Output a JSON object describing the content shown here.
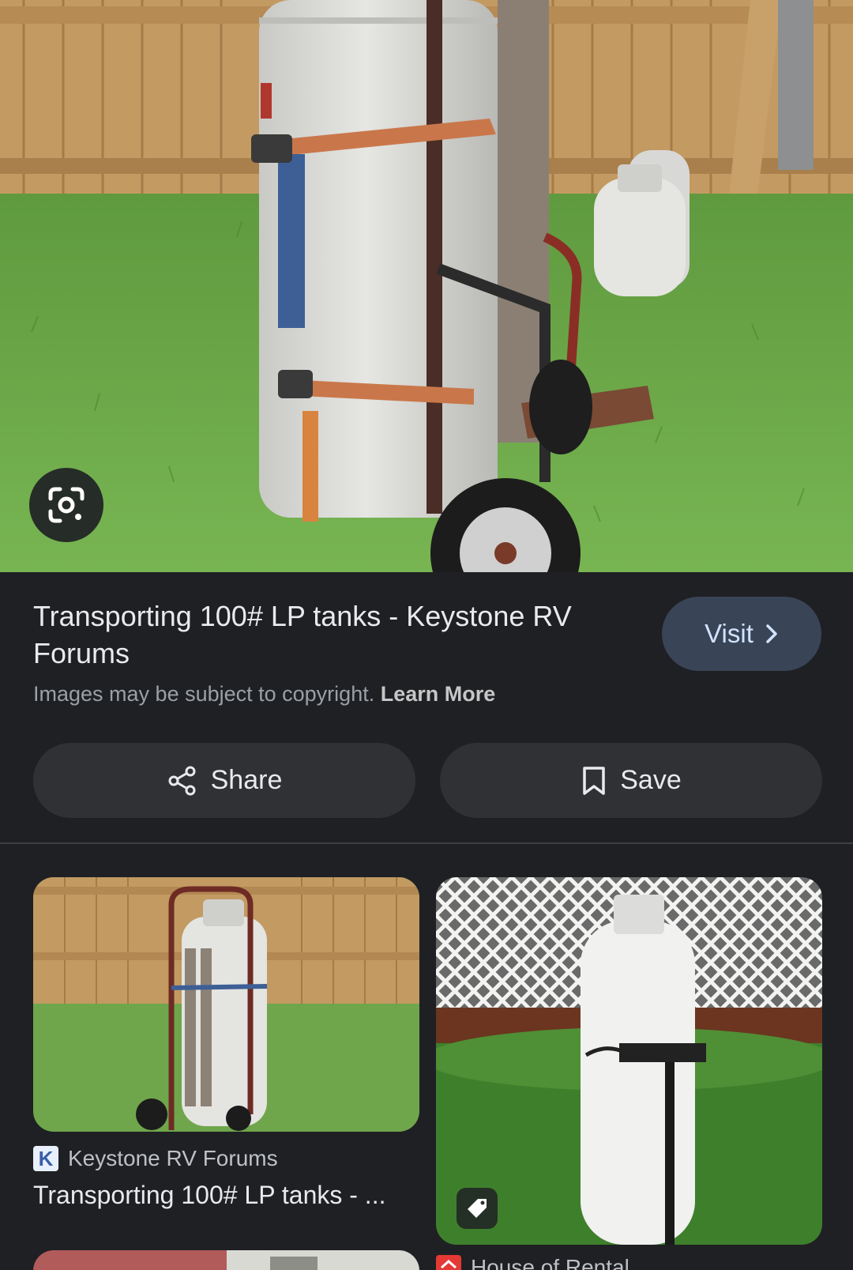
{
  "hero": {
    "image_alt": "White propane tank strapped to a hand truck on grass in front of a wooden fence",
    "lens_icon": "google-lens-icon"
  },
  "result": {
    "title": "Transporting 100# LP tanks - Keystone RV Forums",
    "visit_label": "Visit",
    "copyright_text": "Images may be subject to copyright.",
    "learn_more": "Learn More"
  },
  "actions": {
    "share_label": "Share",
    "save_label": "Save"
  },
  "related": [
    {
      "source": "Keystone RV Forums",
      "title": "Transporting 100# LP tanks - ..."
    },
    {
      "source": "House of Rental",
      "has_price_tag": true
    }
  ],
  "colors": {
    "background": "#1f2024",
    "button_bg": "#303134",
    "visit_bg": "#394457",
    "visit_text": "#d3e3fd"
  }
}
